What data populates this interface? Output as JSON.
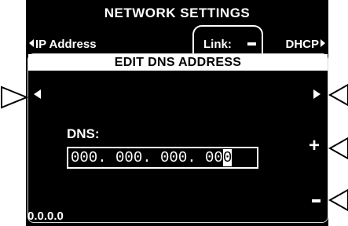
{
  "screen": {
    "title": "NETWORK SETTINGS",
    "tab_left": "IP Address",
    "tab_right": "DHCP",
    "link_label": "Link:"
  },
  "dialog": {
    "title": "EDIT DNS ADDRESS",
    "field_label": "DNS:",
    "value_prefix": "000. 000. 000. 00",
    "value_cursor_char": "0"
  },
  "status": {
    "address": "0.0.0.0"
  },
  "icons": {
    "prev": "triangle-left-icon",
    "next": "triangle-right-icon",
    "increment": "plus-icon",
    "decrement": "minus-icon",
    "callouts": "outline-triangle-pointer-icon"
  }
}
